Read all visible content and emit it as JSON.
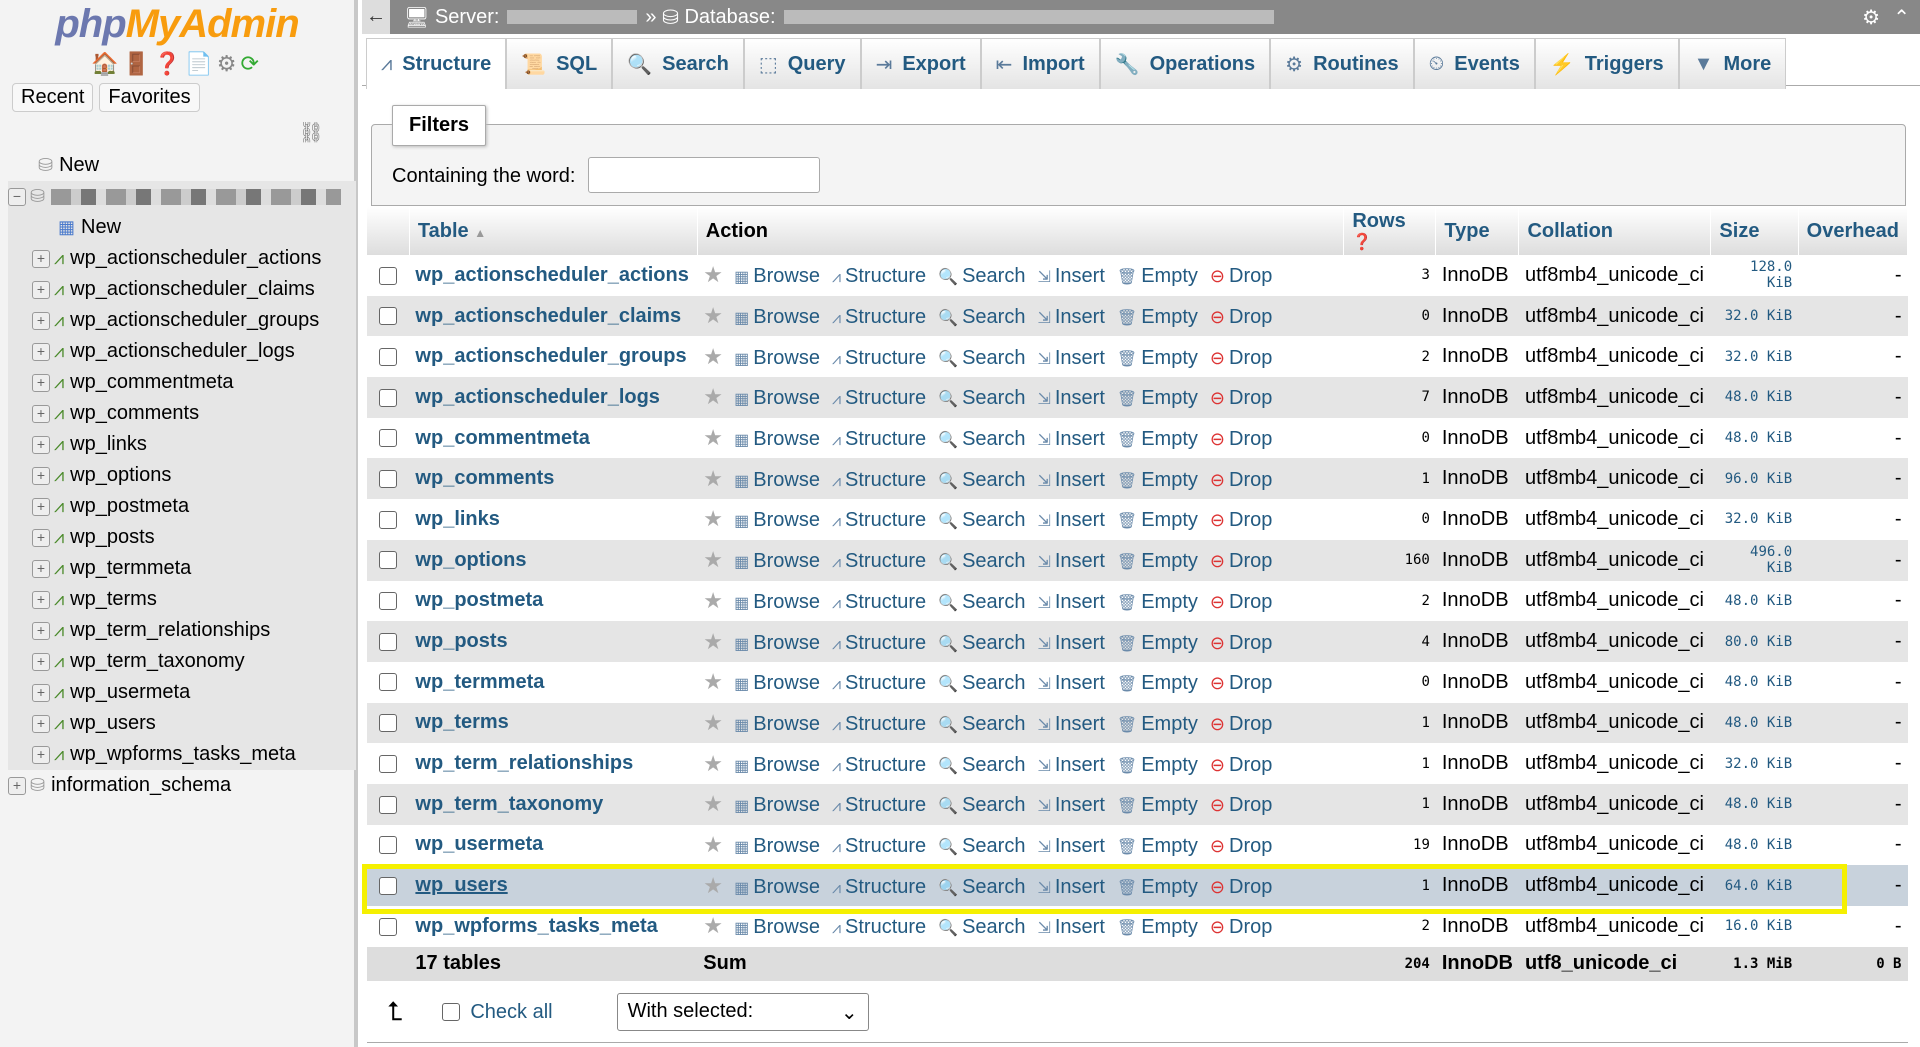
{
  "sidebar": {
    "logo_php": "php",
    "logo_rest": "MyAdmin",
    "recent": "Recent",
    "favorites": "Favorites",
    "new_db": "New",
    "new_table": "New",
    "tables": [
      "wp_actionscheduler_actions",
      "wp_actionscheduler_claims",
      "wp_actionscheduler_groups",
      "wp_actionscheduler_logs",
      "wp_commentmeta",
      "wp_comments",
      "wp_links",
      "wp_options",
      "wp_postmeta",
      "wp_posts",
      "wp_termmeta",
      "wp_terms",
      "wp_term_relationships",
      "wp_term_taxonomy",
      "wp_usermeta",
      "wp_users",
      "wp_wpforms_tasks_meta"
    ],
    "other_db": "information_schema"
  },
  "topbar": {
    "server_label": "Server:",
    "database_label": "Database:",
    "separator": "»"
  },
  "tabs": [
    {
      "label": "Structure",
      "icon": "structure-icon"
    },
    {
      "label": "SQL",
      "icon": "sql-icon"
    },
    {
      "label": "Search",
      "icon": "search-icon"
    },
    {
      "label": "Query",
      "icon": "query-icon"
    },
    {
      "label": "Export",
      "icon": "export-icon"
    },
    {
      "label": "Import",
      "icon": "import-icon"
    },
    {
      "label": "Operations",
      "icon": "wrench-icon"
    },
    {
      "label": "Routines",
      "icon": "routines-icon"
    },
    {
      "label": "Events",
      "icon": "clock-icon"
    },
    {
      "label": "Triggers",
      "icon": "triggers-icon"
    },
    {
      "label": "More",
      "icon": "caret-down-icon"
    }
  ],
  "filters": {
    "legend": "Filters",
    "label": "Containing the word:",
    "value": ""
  },
  "table": {
    "headers": {
      "table": "Table",
      "action": "Action",
      "rows": "Rows",
      "type": "Type",
      "collation": "Collation",
      "size": "Size",
      "overhead": "Overhead"
    },
    "actions": [
      "Browse",
      "Structure",
      "Search",
      "Insert",
      "Empty",
      "Drop"
    ],
    "rows": [
      {
        "name": "wp_actionscheduler_actions",
        "rows": "3",
        "type": "InnoDB",
        "collation": "utf8mb4_unicode_ci",
        "size": "128.0 KiB",
        "overhead": "-"
      },
      {
        "name": "wp_actionscheduler_claims",
        "rows": "0",
        "type": "InnoDB",
        "collation": "utf8mb4_unicode_ci",
        "size": "32.0 KiB",
        "overhead": "-"
      },
      {
        "name": "wp_actionscheduler_groups",
        "rows": "2",
        "type": "InnoDB",
        "collation": "utf8mb4_unicode_ci",
        "size": "32.0 KiB",
        "overhead": "-"
      },
      {
        "name": "wp_actionscheduler_logs",
        "rows": "7",
        "type": "InnoDB",
        "collation": "utf8mb4_unicode_ci",
        "size": "48.0 KiB",
        "overhead": "-"
      },
      {
        "name": "wp_commentmeta",
        "rows": "0",
        "type": "InnoDB",
        "collation": "utf8mb4_unicode_ci",
        "size": "48.0 KiB",
        "overhead": "-"
      },
      {
        "name": "wp_comments",
        "rows": "1",
        "type": "InnoDB",
        "collation": "utf8mb4_unicode_ci",
        "size": "96.0 KiB",
        "overhead": "-"
      },
      {
        "name": "wp_links",
        "rows": "0",
        "type": "InnoDB",
        "collation": "utf8mb4_unicode_ci",
        "size": "32.0 KiB",
        "overhead": "-"
      },
      {
        "name": "wp_options",
        "rows": "160",
        "type": "InnoDB",
        "collation": "utf8mb4_unicode_ci",
        "size": "496.0 KiB",
        "overhead": "-"
      },
      {
        "name": "wp_postmeta",
        "rows": "2",
        "type": "InnoDB",
        "collation": "utf8mb4_unicode_ci",
        "size": "48.0 KiB",
        "overhead": "-"
      },
      {
        "name": "wp_posts",
        "rows": "4",
        "type": "InnoDB",
        "collation": "utf8mb4_unicode_ci",
        "size": "80.0 KiB",
        "overhead": "-"
      },
      {
        "name": "wp_termmeta",
        "rows": "0",
        "type": "InnoDB",
        "collation": "utf8mb4_unicode_ci",
        "size": "48.0 KiB",
        "overhead": "-"
      },
      {
        "name": "wp_terms",
        "rows": "1",
        "type": "InnoDB",
        "collation": "utf8mb4_unicode_ci",
        "size": "48.0 KiB",
        "overhead": "-"
      },
      {
        "name": "wp_term_relationships",
        "rows": "1",
        "type": "InnoDB",
        "collation": "utf8mb4_unicode_ci",
        "size": "32.0 KiB",
        "overhead": "-"
      },
      {
        "name": "wp_term_taxonomy",
        "rows": "1",
        "type": "InnoDB",
        "collation": "utf8mb4_unicode_ci",
        "size": "48.0 KiB",
        "overhead": "-"
      },
      {
        "name": "wp_usermeta",
        "rows": "19",
        "type": "InnoDB",
        "collation": "utf8mb4_unicode_ci",
        "size": "48.0 KiB",
        "overhead": "-"
      },
      {
        "name": "wp_users",
        "rows": "1",
        "type": "InnoDB",
        "collation": "utf8mb4_unicode_ci",
        "size": "64.0 KiB",
        "overhead": "-",
        "highlighted": true
      },
      {
        "name": "wp_wpforms_tasks_meta",
        "rows": "2",
        "type": "InnoDB",
        "collation": "utf8mb4_unicode_ci",
        "size": "16.0 KiB",
        "overhead": "-"
      }
    ],
    "sum": {
      "label": "17 tables",
      "action": "Sum",
      "rows": "204",
      "type": "InnoDB",
      "collation": "utf8_unicode_ci",
      "size": "1.3 MiB",
      "overhead": "0 B"
    }
  },
  "footer": {
    "check_all": "Check all",
    "with_selected": "With selected:"
  }
}
